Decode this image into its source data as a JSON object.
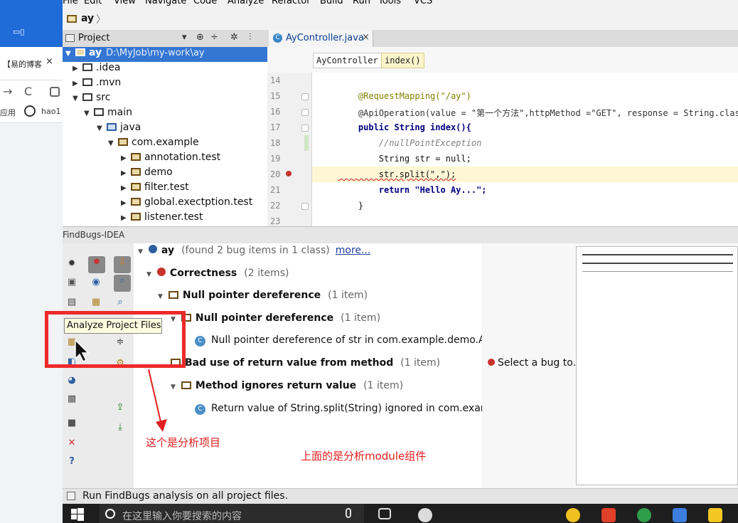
{
  "browser": {
    "tab_title": "【易的博客",
    "tab_close": "×",
    "back": "→",
    "reload": "C",
    "apps_label": "应用",
    "bookmark": "hao1"
  },
  "ide": {
    "menus": [
      "File",
      "Edit",
      "View",
      "Navigate",
      "Code",
      "Analyze",
      "Refactor",
      "Build",
      "Run",
      "Tools",
      "VCS"
    ],
    "breadcrumb_root": "ay",
    "project_panel": {
      "title": "Project",
      "tree": [
        {
          "label": "ay",
          "path": "D:\\MyJob\\my-work\\ay",
          "depth": 0,
          "expanded": true,
          "selected": true
        },
        {
          "label": ".idea",
          "depth": 1,
          "expanded": false
        },
        {
          "label": ".mvn",
          "depth": 1,
          "expanded": false
        },
        {
          "label": "src",
          "depth": 1,
          "expanded": true
        },
        {
          "label": "main",
          "depth": 2,
          "expanded": true
        },
        {
          "label": "java",
          "depth": 3,
          "expanded": true
        },
        {
          "label": "com.example",
          "depth": 4,
          "expanded": true
        },
        {
          "label": "annotation.test",
          "depth": 5,
          "expanded": false
        },
        {
          "label": "demo",
          "depth": 5,
          "expanded": false
        },
        {
          "label": "filter.test",
          "depth": 5,
          "expanded": false
        },
        {
          "label": "global.exectption.test",
          "depth": 5,
          "expanded": false
        },
        {
          "label": "listener.test",
          "depth": 5,
          "expanded": false
        }
      ]
    },
    "editor": {
      "tab_label": "AyController.java",
      "tab_close": "×",
      "crumbs": [
        "AyController",
        "index()"
      ],
      "line_numbers": [
        "14",
        "15",
        "16",
        "17",
        "18",
        "19",
        "20",
        "21",
        "22",
        "23"
      ],
      "lines": [
        "",
        "    @RequestMapping(\"/ay\")",
        "    @ApiOperation(value = \"第一个方法\",httpMethod =\"GET\", response = String.class,",
        "    public String index(){",
        "        //nullPointException",
        "        String str = null;",
        "        str.split(\",\");",
        "        return \"Hello Ay...\";",
        "    }",
        ""
      ],
      "highlight_line": "20"
    },
    "findbugs": {
      "title": "FindBugs-IDEA",
      "root": {
        "label": "ay",
        "summary": "(found 2 bug items in 1 class)",
        "more": "more..."
      },
      "items": [
        {
          "kind": "category",
          "label": "Correctness",
          "count": "(2 items)"
        },
        {
          "kind": "folder",
          "label": "Null pointer dereference",
          "count": "(1 item)"
        },
        {
          "kind": "folder",
          "label": "Null pointer dereference",
          "count": "(1 item)"
        },
        {
          "kind": "class",
          "label": "Null pointer dereference of str in com.example.demo.AyCor",
          "count": ""
        },
        {
          "kind": "folder",
          "label": "Bad use of return value from method",
          "count": "(1 item)"
        },
        {
          "kind": "folder",
          "label": "Method ignores return value",
          "count": "(1 item)"
        },
        {
          "kind": "class",
          "label": "Return value of String.split(String) ignored in com.example.c",
          "count": ""
        }
      ],
      "detail_message": "Select a bug to...",
      "tooltip": "Analyze Project Files"
    },
    "status_text": "Run FindBugs analysis on all project files."
  },
  "annotations": {
    "project_note": "这个是分析项目",
    "module_note": "上面的是分析module组件"
  },
  "taskbar": {
    "search_placeholder": "在这里输入你要搜索的内容"
  },
  "colors": {
    "selection": "#3476d2",
    "annotation_red": "#ee2a2a",
    "keyword": "#000080",
    "string": "#008000",
    "annotation": "#808000"
  }
}
